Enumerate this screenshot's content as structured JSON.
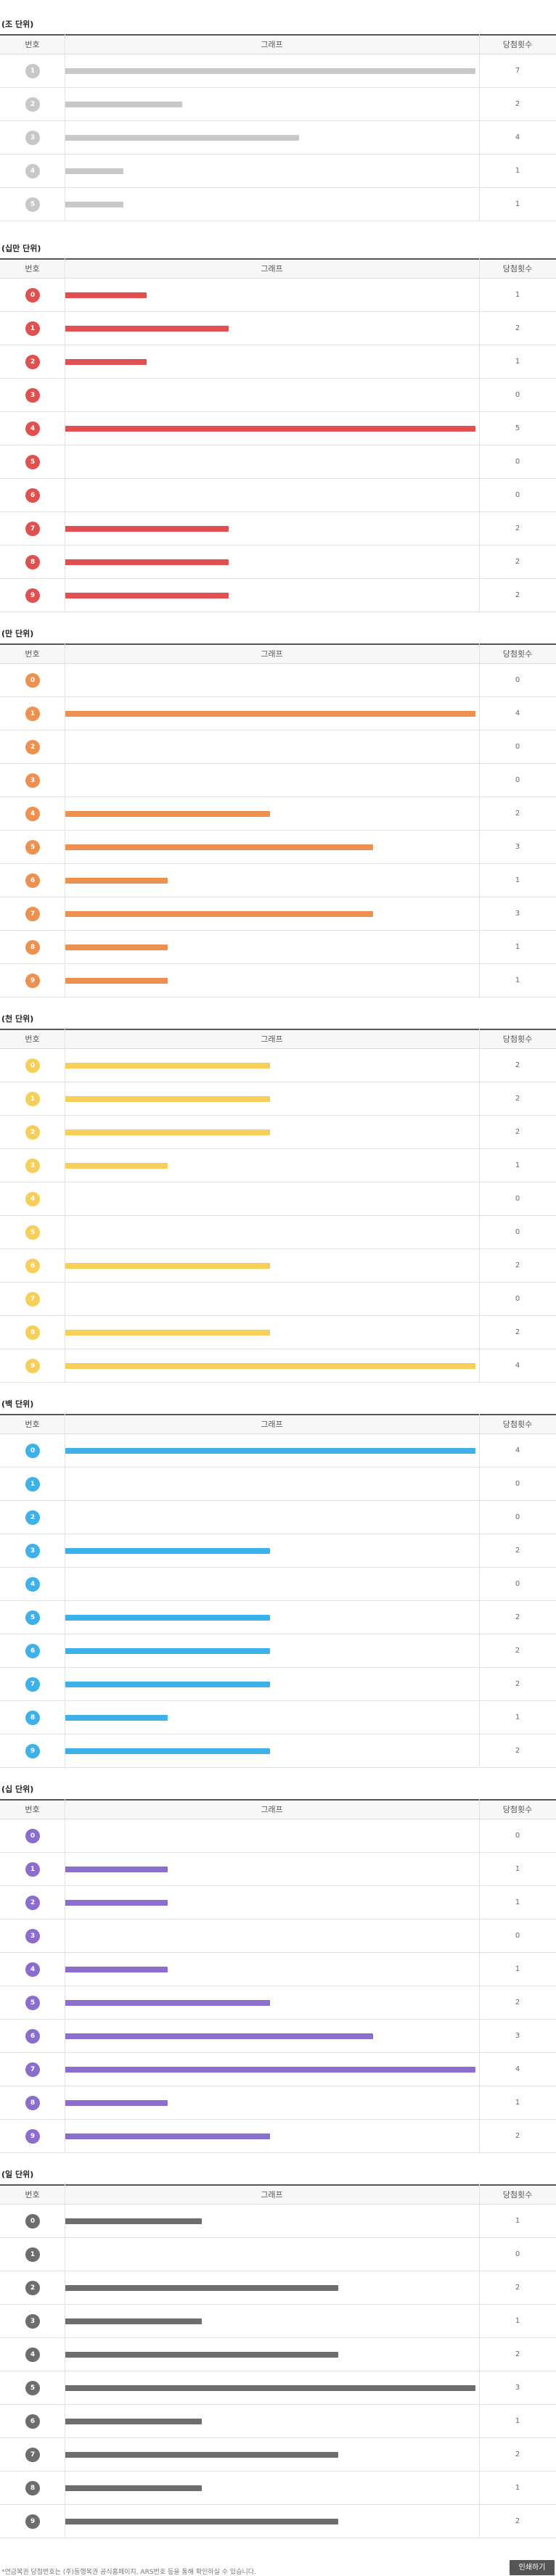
{
  "header": {
    "col_num": "번호",
    "col_graph": "그래프",
    "col_count": "당첨횟수"
  },
  "chart_data": [
    {
      "type": "bar",
      "title": "(조 단위)",
      "color": "#c8c8c8",
      "categories": [
        "1",
        "2",
        "3",
        "4",
        "5"
      ],
      "values": [
        7,
        2,
        4,
        1,
        1
      ]
    },
    {
      "type": "bar",
      "title": "(십만 단위)",
      "color": "#e05050",
      "categories": [
        "0",
        "1",
        "2",
        "3",
        "4",
        "5",
        "6",
        "7",
        "8",
        "9"
      ],
      "values": [
        1,
        2,
        1,
        0,
        5,
        0,
        0,
        2,
        2,
        2
      ]
    },
    {
      "type": "bar",
      "title": "(만 단위)",
      "color": "#ee9050",
      "categories": [
        "0",
        "1",
        "2",
        "3",
        "4",
        "5",
        "6",
        "7",
        "8",
        "9"
      ],
      "values": [
        0,
        4,
        0,
        0,
        2,
        3,
        1,
        3,
        1,
        1
      ]
    },
    {
      "type": "bar",
      "title": "(천 단위)",
      "color": "#f5cf5a",
      "categories": [
        "0",
        "1",
        "2",
        "3",
        "4",
        "5",
        "6",
        "7",
        "8",
        "9"
      ],
      "values": [
        2,
        2,
        2,
        1,
        0,
        0,
        2,
        0,
        2,
        4
      ]
    },
    {
      "type": "bar",
      "title": "(백 단위)",
      "color": "#3eb1e8",
      "categories": [
        "0",
        "1",
        "2",
        "3",
        "4",
        "5",
        "6",
        "7",
        "8",
        "9"
      ],
      "values": [
        4,
        0,
        0,
        2,
        0,
        2,
        2,
        2,
        1,
        2
      ]
    },
    {
      "type": "bar",
      "title": "(십 단위)",
      "color": "#8a6dcc",
      "categories": [
        "0",
        "1",
        "2",
        "3",
        "4",
        "5",
        "6",
        "7",
        "8",
        "9"
      ],
      "values": [
        0,
        1,
        1,
        0,
        1,
        2,
        3,
        4,
        1,
        2
      ]
    },
    {
      "type": "bar",
      "title": "(일 단위)",
      "color": "#6d6d6d",
      "categories": [
        "0",
        "1",
        "2",
        "3",
        "4",
        "5",
        "6",
        "7",
        "8",
        "9"
      ],
      "values": [
        1,
        0,
        2,
        1,
        2,
        3,
        1,
        2,
        1,
        2
      ]
    }
  ],
  "footer": {
    "note": "*연금복권 당첨번호는 (주)동행복권 공식홈페이지, ARS번호 등을 통해 확인하실 수 있습니다.",
    "print_button": "인쇄하기"
  }
}
